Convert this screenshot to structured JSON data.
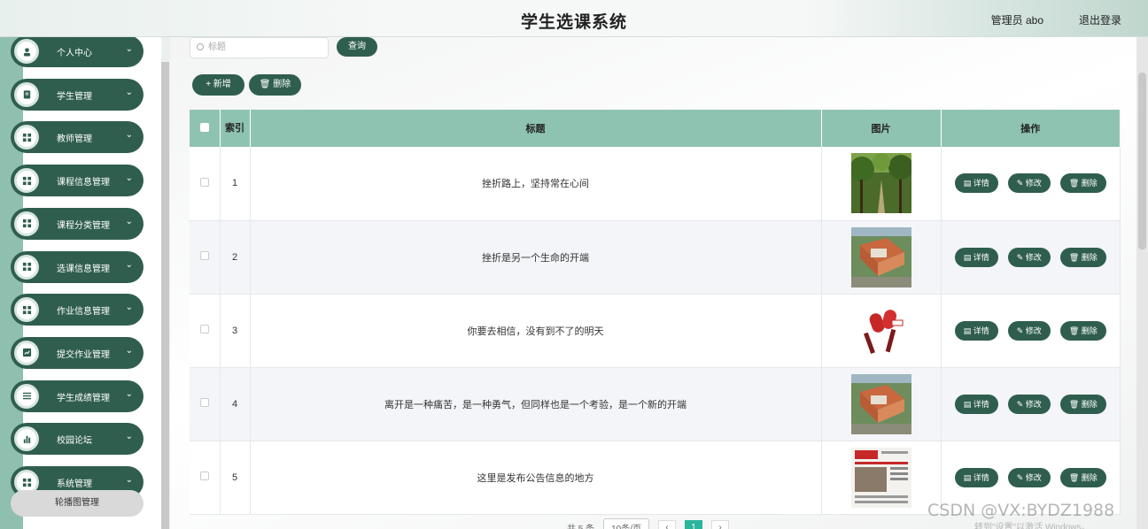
{
  "header": {
    "title": "学生选课系统",
    "admin": "管理员 abo",
    "logout": "退出登录"
  },
  "sidebar": {
    "items": [
      {
        "label": "个人中心",
        "icon": "user-icon"
      },
      {
        "label": "学生管理",
        "icon": "clipboard-icon"
      },
      {
        "label": "教师管理",
        "icon": "grid-icon"
      },
      {
        "label": "课程信息管理",
        "icon": "grid-icon"
      },
      {
        "label": "课程分类管理",
        "icon": "grid-icon"
      },
      {
        "label": "选课信息管理",
        "icon": "grid-icon"
      },
      {
        "label": "作业信息管理",
        "icon": "grid-icon"
      },
      {
        "label": "提交作业管理",
        "icon": "chart-box-icon"
      },
      {
        "label": "学生成绩管理",
        "icon": "list-icon"
      },
      {
        "label": "校园论坛",
        "icon": "bar-chart-icon"
      },
      {
        "label": "系统管理",
        "icon": "grid-icon"
      }
    ],
    "sub_item": "轮播图管理"
  },
  "toolbar": {
    "search_placeholder": "标题",
    "query": "查询",
    "add": "+ 新增",
    "delete": "删除"
  },
  "table": {
    "headers": {
      "index": "索引",
      "title": "标题",
      "image": "图片",
      "actions": "操作"
    },
    "rows": [
      {
        "index": "1",
        "title": "挫折路上，坚持常在心间",
        "image": "forest"
      },
      {
        "index": "2",
        "title": "挫折是另一个生命的开端",
        "image": "campus"
      },
      {
        "index": "3",
        "title": "你要去相信，没有到不了的明天",
        "image": "microphones"
      },
      {
        "index": "4",
        "title": "离开是一种痛苦，是一种勇气，但同样也是一个考验，是一个新的开端",
        "image": "campus"
      },
      {
        "index": "5",
        "title": "这里是发布公告信息的地方",
        "image": "newspaper"
      }
    ],
    "ops": {
      "detail": "详情",
      "edit": "修改",
      "delete": "删除"
    }
  },
  "pager": {
    "total": "共 5 条",
    "size": "10条/页",
    "current": "1"
  },
  "watermark": "CSDN @VX:BYDZ1988",
  "win_hint": "转到\"设置\"以激活 Windows。"
}
